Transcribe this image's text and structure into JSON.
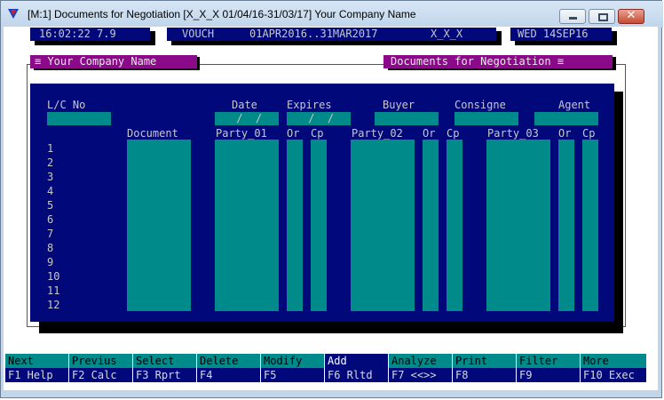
{
  "window": {
    "title": "[M:1]  Documents for Negotiation  [X_X_X  01/04/16-31/03/17]  Your Company Name"
  },
  "status": {
    "time": "16:02:22 7.9",
    "module": "VOUCH",
    "period": "01APR2016..31MAR2017",
    "code": "X_X_X",
    "date": "WED 14SEP16"
  },
  "banner": {
    "company": "≡ Your Company Name",
    "screen": "Documents for Negotiation ≡"
  },
  "form": {
    "labels": {
      "lc_no": "L/C No",
      "date": "Date",
      "expires": "Expires",
      "buyer": "Buyer",
      "consigne": "Consigne",
      "agent": "Agent"
    },
    "date_value": " /  /",
    "expires_value": " /  /",
    "columns": {
      "document": "Document",
      "party1": "Party_01",
      "or1": "Or",
      "cp1": "Cp",
      "party2": "Party_02",
      "or2": "Or",
      "cp2": "Cp",
      "party3": "Party_03",
      "or3": "Or",
      "cp3": "Cp"
    },
    "row_numbers": [
      "1",
      "2",
      "3",
      "4",
      "5",
      "6",
      "7",
      "8",
      "9",
      "10",
      "11",
      "12"
    ]
  },
  "fkeys": [
    {
      "top": "Next",
      "bottom": "F1 Help"
    },
    {
      "top": "Previus",
      "bottom": "F2 Calc"
    },
    {
      "top": "Select",
      "bottom": "F3 Rprt"
    },
    {
      "top": "Delete",
      "bottom": "F4"
    },
    {
      "top": "Modify",
      "bottom": "F5"
    },
    {
      "top": "Add",
      "bottom": "F6 Rltd"
    },
    {
      "top": "Analyze",
      "bottom": "F7 <<>>"
    },
    {
      "top": "Print",
      "bottom": "F8"
    },
    {
      "top": "Filter",
      "bottom": "F9"
    },
    {
      "top": "More",
      "bottom": "F10 Exec"
    }
  ],
  "colors": {
    "navy": "#00087a",
    "teal": "#008a8a",
    "purple": "#8a0a8a"
  }
}
